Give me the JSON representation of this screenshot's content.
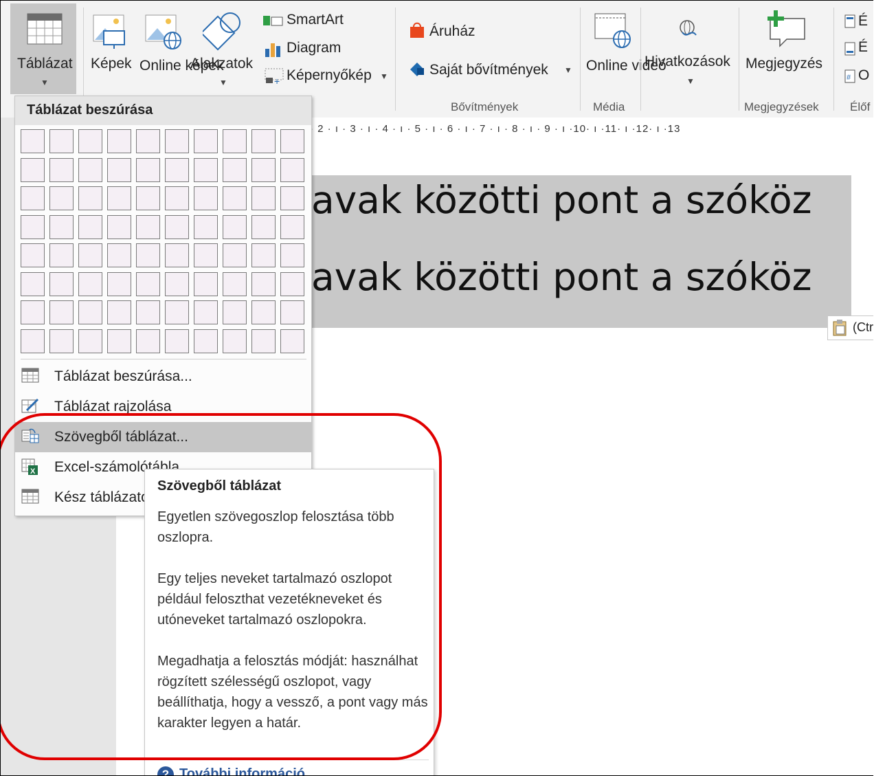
{
  "ribbon": {
    "table_label": "Táblázat",
    "pictures_label": "Képek",
    "online_pictures_label": "Online képek",
    "shapes_label": "Alakzatok",
    "smartart_label": "SmartArt",
    "chart_label": "Diagram",
    "screenshot_label": "Képernyőkép",
    "store_label": "Áruház",
    "my_addins_label": "Saját bővítmények",
    "addins_group": "Bővítmények",
    "online_video_label": "Online videó",
    "media_group": "Média",
    "links_label": "Hivatkozások",
    "comment_label": "Megjegyzés",
    "comments_group": "Megjegyzések",
    "header_footer_group": "Élőf",
    "hf_items": [
      "É",
      "É",
      "O"
    ]
  },
  "ruler": {
    "text": "· 2 · ı · 3 · ı · 4 · ı · 5 · ı · 6 · ı · 7 · ı · 8 · ı · 9 · ı ·10· ı ·11· ı ·12· ı ·13"
  },
  "document": {
    "line1": "avak közötti pont a szóköz",
    "line2": "avak közötti pont a szóköz",
    "paste_label": "(Ctr"
  },
  "dropdown": {
    "header": "Táblázat beszúrása",
    "grid_cols": 10,
    "grid_rows": 8,
    "items": [
      {
        "label": "Táblázat beszúrása..."
      },
      {
        "label": "Táblázat rajzolása"
      },
      {
        "label": "Szövegből táblázat..."
      },
      {
        "label": "Excel-számolótábla"
      },
      {
        "label": "Kész táblázatok"
      }
    ]
  },
  "tooltip": {
    "title": "Szövegből táblázat",
    "p1": "Egyetlen szövegoszlop felosztása több oszlopra.",
    "p2": "Egy teljes neveket tartalmazó oszlopot például feloszthat vezetékneveket és utóneveket tartalmazó oszlopokra.",
    "p3": "Megadhatja a felosztás módját: használhat rögzített szélességű oszlopot, vagy beállíthatja, hogy a vessző, a pont vagy más karakter legyen a határ.",
    "more": "További információ"
  },
  "colors": {
    "annotation": "#e00000",
    "link": "#2b579a",
    "store_icon": "#e8471d",
    "addin_icon": "#1f6bb0",
    "comment_plus": "#2e9e44"
  }
}
